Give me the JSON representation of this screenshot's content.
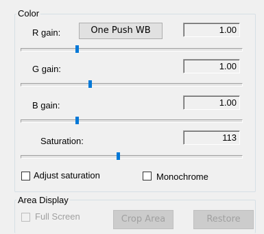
{
  "color_group": {
    "title": "Color",
    "r_gain": {
      "label": "R gain:",
      "value": "1.00",
      "slider_position": 0.25
    },
    "one_push_wb_label": "One Push WB",
    "g_gain": {
      "label": "G gain:",
      "value": "1.00",
      "slider_position": 0.31
    },
    "b_gain": {
      "label": "B gain:",
      "value": "1.00",
      "slider_position": 0.25
    },
    "saturation": {
      "label": "Saturation:",
      "value": "113",
      "slider_position": 0.44
    },
    "adjust_saturation": {
      "label": "Adjust saturation",
      "checked": false
    },
    "monochrome": {
      "label": "Monochrome",
      "checked": false
    }
  },
  "area_display_group": {
    "title": "Area Display",
    "full_screen": {
      "label": "Full Screen",
      "checked": false,
      "enabled": false
    },
    "crop_area_label": "Crop Area",
    "restore_label": "Restore"
  },
  "colors": {
    "slider_thumb": "#0078d7",
    "background": "#f0f0f0"
  }
}
